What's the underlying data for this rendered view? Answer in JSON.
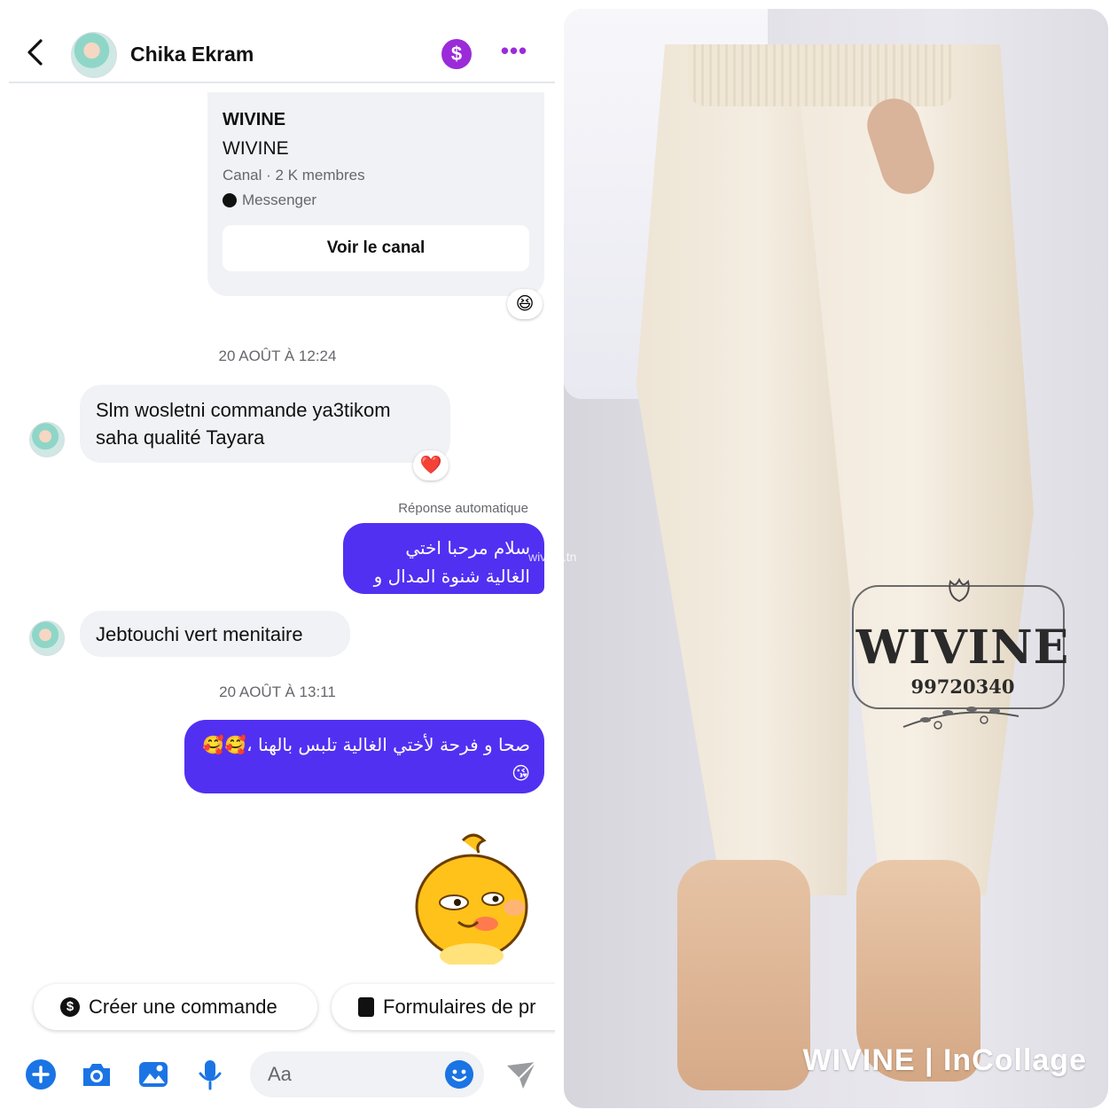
{
  "header": {
    "contact_name": "Chika Ekram",
    "pay_symbol": "$",
    "more_symbol": "•••"
  },
  "channel_card": {
    "title": "WIVINE",
    "subtitle": "WIVINE",
    "meta": "Canal · 2 K membres",
    "source": "Messenger",
    "button": "Voir le canal",
    "reaction": "😆"
  },
  "messages": [
    {
      "type": "timestamp",
      "text": "20 AOÛT À 12:24"
    },
    {
      "type": "incoming",
      "text": "Slm wosletni commande ya3tikom saha qualité Tayara",
      "reaction": "❤️"
    },
    {
      "type": "auto_label",
      "text": "Réponse automatique"
    },
    {
      "type": "outgoing",
      "text": "سلام مرحبا اختي الغالية شنوة المدال و الطاي"
    },
    {
      "type": "incoming",
      "text": "Jebtouchi vert menitaire"
    },
    {
      "type": "timestamp",
      "text": "20 AOÛT À 13:11"
    },
    {
      "type": "outgoing",
      "text": "صحا و فرحة لأختي الغالية تلبس بالهنا ،🥰🥰😘"
    }
  ],
  "quick_actions": [
    {
      "label": "Créer une commande",
      "icon": "dollar-icon"
    },
    {
      "label": "Formulaires de pr",
      "icon": "form-icon"
    }
  ],
  "composer": {
    "placeholder": "Aa",
    "icons": [
      "plus-icon",
      "camera-icon",
      "image-icon",
      "microphone-icon",
      "emoji-icon",
      "send-icon"
    ]
  },
  "photo": {
    "brand": "WIVINE",
    "phone": "99720340",
    "watermark": "wivine.tn",
    "collage_mark": "WIVINE | InCollage"
  },
  "colors": {
    "accent_purple": "#9b2bd9",
    "outgoing_bubble": "#5230f2",
    "incoming_bubble": "#f0f2f5",
    "icon_blue": "#1b74e4"
  }
}
